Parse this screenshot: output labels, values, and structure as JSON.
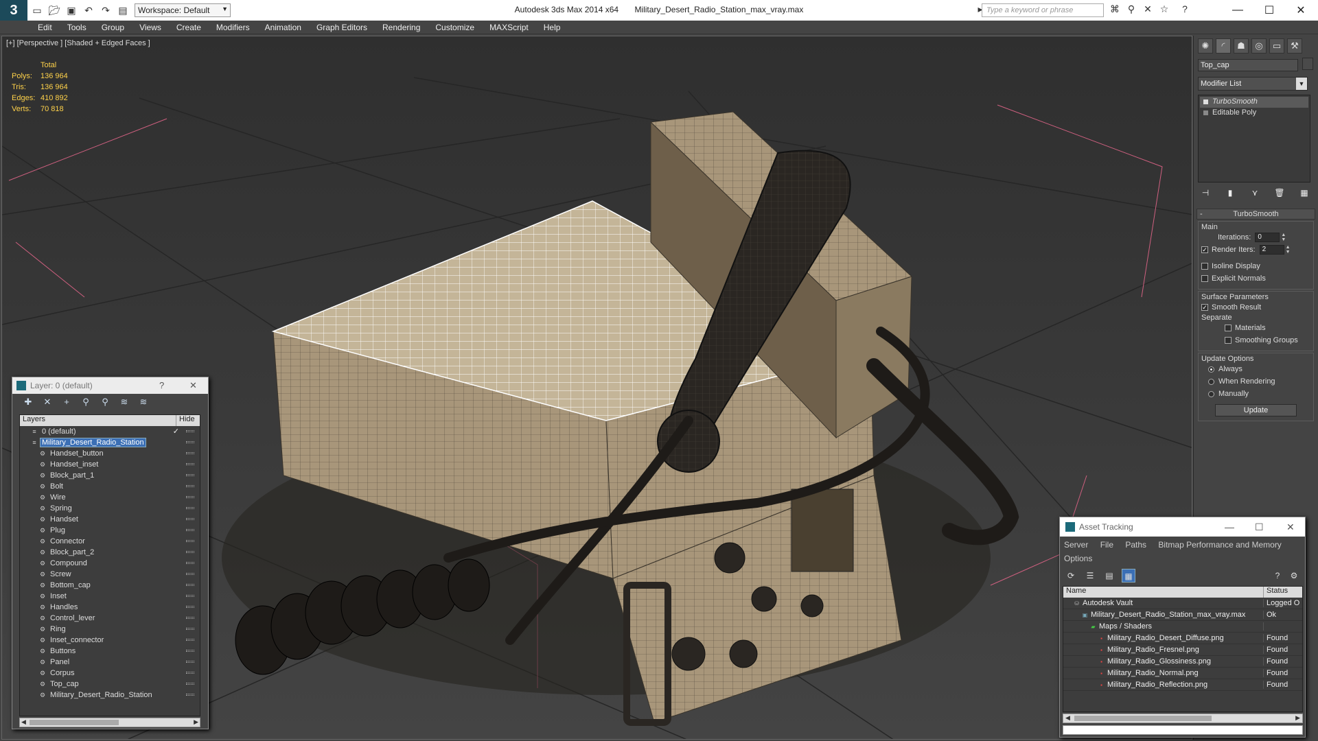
{
  "app": {
    "logo_glyph": "3",
    "title": "Autodesk 3ds Max  2014 x64",
    "filename": "Military_Desert_Radio_Station_max_vray.max",
    "workspace": "Workspace: Default",
    "search_placeholder": "Type a keyword or phrase"
  },
  "menu": [
    "Edit",
    "Tools",
    "Group",
    "Views",
    "Create",
    "Modifiers",
    "Animation",
    "Graph Editors",
    "Rendering",
    "Customize",
    "MAXScript",
    "Help"
  ],
  "viewport": {
    "label": "[+] [Perspective ] [Shaded + Edged Faces ]",
    "stats": {
      "header": "Total",
      "rows": [
        {
          "label": "Polys:",
          "value": "136 964"
        },
        {
          "label": "Tris:",
          "value": "136 964"
        },
        {
          "label": "Edges:",
          "value": "410 892"
        },
        {
          "label": "Verts:",
          "value": "70 818"
        }
      ]
    }
  },
  "command_panel": {
    "object_name": "Top_cap",
    "modifier_list": "Modifier List",
    "stack": [
      {
        "label": "TurboSmooth",
        "selected": true
      },
      {
        "label": "Editable Poly",
        "selected": false
      }
    ],
    "turbosmooth": {
      "title": "TurboSmooth",
      "main_label": "Main",
      "iterations_label": "Iterations:",
      "iterations_value": "0",
      "render_iters_label": "Render Iters:",
      "render_iters_value": "2",
      "isoline_label": "Isoline Display",
      "explicit_normals_label": "Explicit Normals",
      "surface_label": "Surface Parameters",
      "smooth_result_label": "Smooth Result",
      "separate_label": "Separate",
      "materials_label": "Materials",
      "smoothing_groups_label": "Smoothing Groups",
      "update_options_label": "Update Options",
      "always_label": "Always",
      "when_rendering_label": "When Rendering",
      "manually_label": "Manually",
      "update_button": "Update"
    }
  },
  "layer_dialog": {
    "title": "Layer: 0 (default)",
    "col_layers": "Layers",
    "col_hide": "Hide",
    "layers": [
      {
        "name": "0 (default)",
        "level": 1,
        "selected": false,
        "current": true,
        "type": "layer"
      },
      {
        "name": "Military_Desert_Radio_Station",
        "level": 1,
        "selected": true,
        "current": false,
        "type": "layer"
      },
      {
        "name": "Handset_button",
        "level": 2,
        "selected": false,
        "current": false,
        "type": "object"
      },
      {
        "name": "Handset_inset",
        "level": 2,
        "selected": false,
        "current": false,
        "type": "object"
      },
      {
        "name": "Block_part_1",
        "level": 2,
        "selected": false,
        "current": false,
        "type": "object"
      },
      {
        "name": "Bolt",
        "level": 2,
        "selected": false,
        "current": false,
        "type": "object"
      },
      {
        "name": "Wire",
        "level": 2,
        "selected": false,
        "current": false,
        "type": "object"
      },
      {
        "name": "Spring",
        "level": 2,
        "selected": false,
        "current": false,
        "type": "object"
      },
      {
        "name": "Handset",
        "level": 2,
        "selected": false,
        "current": false,
        "type": "object"
      },
      {
        "name": "Plug",
        "level": 2,
        "selected": false,
        "current": false,
        "type": "object"
      },
      {
        "name": "Connector",
        "level": 2,
        "selected": false,
        "current": false,
        "type": "object"
      },
      {
        "name": "Block_part_2",
        "level": 2,
        "selected": false,
        "current": false,
        "type": "object"
      },
      {
        "name": "Compound",
        "level": 2,
        "selected": false,
        "current": false,
        "type": "object"
      },
      {
        "name": "Screw",
        "level": 2,
        "selected": false,
        "current": false,
        "type": "object"
      },
      {
        "name": "Bottom_cap",
        "level": 2,
        "selected": false,
        "current": false,
        "type": "object"
      },
      {
        "name": "Inset",
        "level": 2,
        "selected": false,
        "current": false,
        "type": "object"
      },
      {
        "name": "Handles",
        "level": 2,
        "selected": false,
        "current": false,
        "type": "object"
      },
      {
        "name": "Control_lever",
        "level": 2,
        "selected": false,
        "current": false,
        "type": "object"
      },
      {
        "name": "Ring",
        "level": 2,
        "selected": false,
        "current": false,
        "type": "object"
      },
      {
        "name": "Inset_connector",
        "level": 2,
        "selected": false,
        "current": false,
        "type": "object"
      },
      {
        "name": "Buttons",
        "level": 2,
        "selected": false,
        "current": false,
        "type": "object"
      },
      {
        "name": "Panel",
        "level": 2,
        "selected": false,
        "current": false,
        "type": "object"
      },
      {
        "name": "Corpus",
        "level": 2,
        "selected": false,
        "current": false,
        "type": "object"
      },
      {
        "name": "Top_cap",
        "level": 2,
        "selected": false,
        "current": false,
        "type": "object"
      },
      {
        "name": "Military_Desert_Radio_Station",
        "level": 2,
        "selected": false,
        "current": false,
        "type": "object"
      }
    ]
  },
  "asset_dialog": {
    "title": "Asset Tracking",
    "menu": [
      "Server",
      "File",
      "Paths",
      "Bitmap Performance and Memory",
      "Options"
    ],
    "col_name": "Name",
    "col_status": "Status",
    "rows": [
      {
        "name": "Autodesk Vault",
        "status": "Logged O",
        "level": 0,
        "icon": "vault-icon"
      },
      {
        "name": "Military_Desert_Radio_Station_max_vray.max",
        "status": "Ok",
        "level": 1,
        "icon": "max-file-icon"
      },
      {
        "name": "Maps / Shaders",
        "status": "",
        "level": 2,
        "icon": "maps-icon"
      },
      {
        "name": "Military_Radio_Desert_Diffuse.png",
        "status": "Found",
        "level": 3,
        "icon": "png-icon"
      },
      {
        "name": "Military_Radio_Fresnel.png",
        "status": "Found",
        "level": 3,
        "icon": "png-icon"
      },
      {
        "name": "Military_Radio_Glossiness.png",
        "status": "Found",
        "level": 3,
        "icon": "png-icon"
      },
      {
        "name": "Military_Radio_Normal.png",
        "status": "Found",
        "level": 3,
        "icon": "png-icon"
      },
      {
        "name": "Military_Radio_Reflection.png",
        "status": "Found",
        "level": 3,
        "icon": "png-icon"
      }
    ]
  },
  "colors": {
    "stats_text": "#ffd24a",
    "selection": "#3b6fb5",
    "model_tan": "#a8967a",
    "wire_white": "#ffffff",
    "guide_pink": "#d06080"
  }
}
